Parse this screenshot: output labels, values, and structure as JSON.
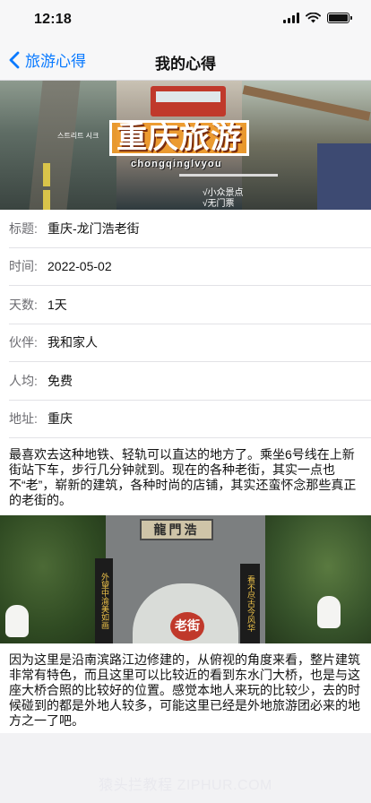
{
  "status_bar": {
    "time": "12:18"
  },
  "nav": {
    "back_label": "旅游心得",
    "title": "我的心得"
  },
  "hero": {
    "title": "重庆旅游",
    "subtitle": "chongqinglvyou",
    "tags": [
      "√小众景点",
      "√无门票"
    ],
    "caption": "스트리트 시크"
  },
  "details": [
    {
      "label": "标题:",
      "value": "重庆-龙门浩老街"
    },
    {
      "label": "时间:",
      "value": "2022-05-02"
    },
    {
      "label": "天数:",
      "value": "1天"
    },
    {
      "label": "伙伴:",
      "value": "我和家人"
    },
    {
      "label": "人均:",
      "value": "免费"
    },
    {
      "label": "地址:",
      "value": "重庆"
    }
  ],
  "paragraphs": [
    "最喜欢去这种地铁、轻轨可以直达的地方了。乘坐6号线在上新街站下车，步行几分钟就到。现在的各种老街，其实一点也不“老”，崭新的建筑，各种时尚的店铺，其实还蛮怀念那些真正的老街的。",
    "因为这里是沿南滨路江边修建的，从俯视的角度来看，整片建筑非常有特色，而且这里可以比较近的看到东水门大桥，也是与这座大桥合照的比较好的位置。感觉本地人来玩的比较少，去的时候碰到的都是外地人较多，可能这里已经是外地旅游团必来的地方之一了吧。"
  ],
  "photo": {
    "plaque": "龍門浩",
    "couplet_left": "外望中渝美如画",
    "couplet_right": "看不尽古今风华",
    "sign": "老街"
  },
  "watermark": "猿头拦教程 ZIPHUR.COM"
}
